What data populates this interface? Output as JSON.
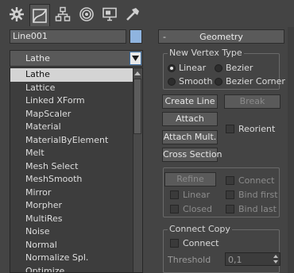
{
  "tabs": [
    {
      "icon": "create-icon"
    },
    {
      "icon": "modify-icon",
      "active": true
    },
    {
      "icon": "hierarchy-icon"
    },
    {
      "icon": "motion-icon"
    },
    {
      "icon": "display-icon"
    },
    {
      "icon": "utilities-icon"
    }
  ],
  "object": {
    "name": "Line001",
    "color": "#8fb4df"
  },
  "modifier_list": {
    "selected": "Lathe",
    "items": [
      "Lathe",
      "Lattice",
      "Linked XForm",
      "MapScaler",
      "Material",
      "MaterialByElement",
      "Melt",
      "Mesh Select",
      "MeshSmooth",
      "Mirror",
      "Morpher",
      "MultiRes",
      "Noise",
      "Normal",
      "Normalize Spl.",
      "Optimize"
    ]
  },
  "geometry": {
    "title": "Geometry",
    "toggle": "-",
    "vertex_type": {
      "label": "New Vertex Type",
      "linear": "Linear",
      "bezier": "Bezier",
      "smooth": "Smooth",
      "bezier_corner": "Bezier Corner",
      "selected": "Linear"
    },
    "create_line": "Create Line",
    "break": "Break",
    "attach": "Attach",
    "reorient": "Reorient",
    "attach_mult": "Attach Mult.",
    "cross_section": "Cross Section",
    "refine": "Refine",
    "connect": "Connect",
    "linear": "Linear",
    "bind_first": "Bind first",
    "closed": "Closed",
    "bind_last": "Bind last",
    "connect_copy": {
      "label": "Connect Copy",
      "connect": "Connect",
      "threshold_label": "Threshold",
      "threshold_value": "0,1"
    }
  }
}
